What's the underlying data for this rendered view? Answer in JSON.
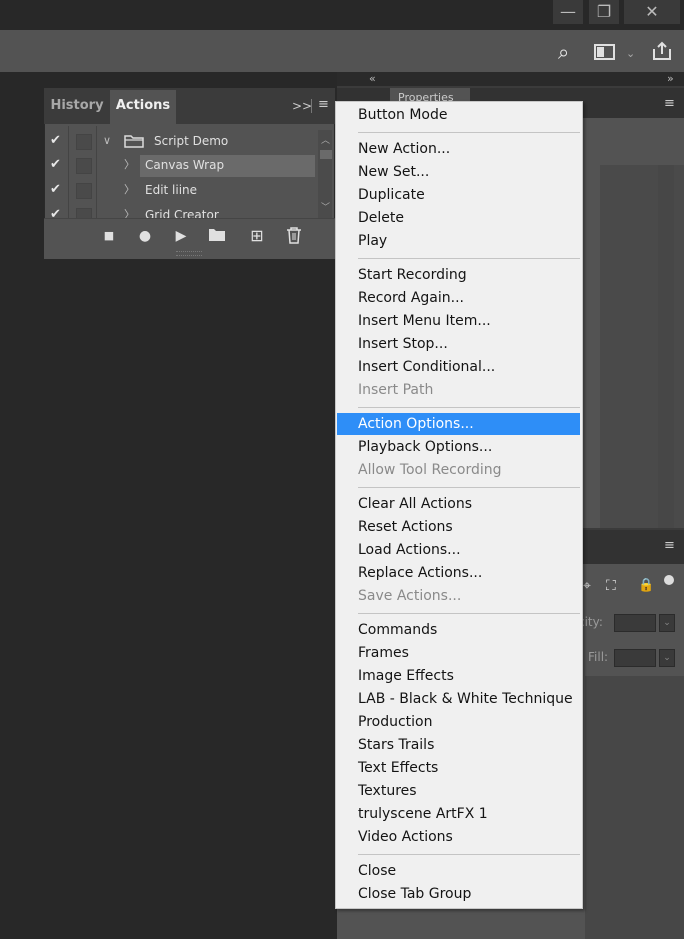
{
  "window": {
    "minimize_glyph": "—",
    "restore_glyph": "❐",
    "close_glyph": "✕",
    "search_glyph": "⌕",
    "share_glyph": "⇪"
  },
  "dock": {
    "collapse_left": "«",
    "collapse_right": "»",
    "properties_tab_label": "Properties",
    "panel_menu_glyph": "≡",
    "opacity_label": "city:",
    "fill_label": "Fill:"
  },
  "actions_panel": {
    "tabs": [
      "History",
      "Actions"
    ],
    "expand_glyph": ">>",
    "menu_glyph": "≡",
    "rows": [
      {
        "checked": "✔",
        "twisty": "∨",
        "label": "Script Demo",
        "icon": "folder-icon"
      },
      {
        "checked": "✔",
        "twisty": "〉",
        "label": "Canvas Wrap",
        "selected": true
      },
      {
        "checked": "✔",
        "twisty": "〉",
        "label": "Edit liine"
      },
      {
        "checked": "✔",
        "twisty": "〉",
        "label": "Grid Creator"
      }
    ],
    "controls": {
      "stop": "■",
      "record": "●",
      "play": "▶",
      "new_set": "▬",
      "new_action": "⊞",
      "delete": "🗑"
    }
  },
  "menu": {
    "items": [
      {
        "label": "Button Mode"
      },
      {
        "label": "New Action..."
      },
      {
        "label": "New Set..."
      },
      {
        "label": "Duplicate"
      },
      {
        "label": "Delete"
      },
      {
        "label": "Play"
      },
      {
        "label": "Start Recording"
      },
      {
        "label": "Record Again..."
      },
      {
        "label": "Insert Menu Item..."
      },
      {
        "label": "Insert Stop..."
      },
      {
        "label": "Insert Conditional..."
      },
      {
        "label": "Insert Path",
        "disabled": true
      },
      {
        "label": "Action Options...",
        "highlighted": true
      },
      {
        "label": "Playback Options..."
      },
      {
        "label": "Allow Tool Recording",
        "disabled": true
      },
      {
        "label": "Clear All Actions"
      },
      {
        "label": "Reset Actions"
      },
      {
        "label": "Load Actions..."
      },
      {
        "label": "Replace Actions..."
      },
      {
        "label": "Save Actions...",
        "disabled": true
      },
      {
        "label": "Commands"
      },
      {
        "label": "Frames"
      },
      {
        "label": "Image Effects"
      },
      {
        "label": "LAB - Black & White Technique"
      },
      {
        "label": "Production"
      },
      {
        "label": "Stars Trails"
      },
      {
        "label": "Text Effects"
      },
      {
        "label": "Textures"
      },
      {
        "label": "trulyscene ArtFX 1"
      },
      {
        "label": "Video Actions"
      },
      {
        "label": "Close"
      },
      {
        "label": "Close Tab Group"
      }
    ]
  },
  "colors": {
    "menu_highlight": "#2e8ef7",
    "menu_bg": "#f0f0f0",
    "panel_bg": "#535353"
  }
}
